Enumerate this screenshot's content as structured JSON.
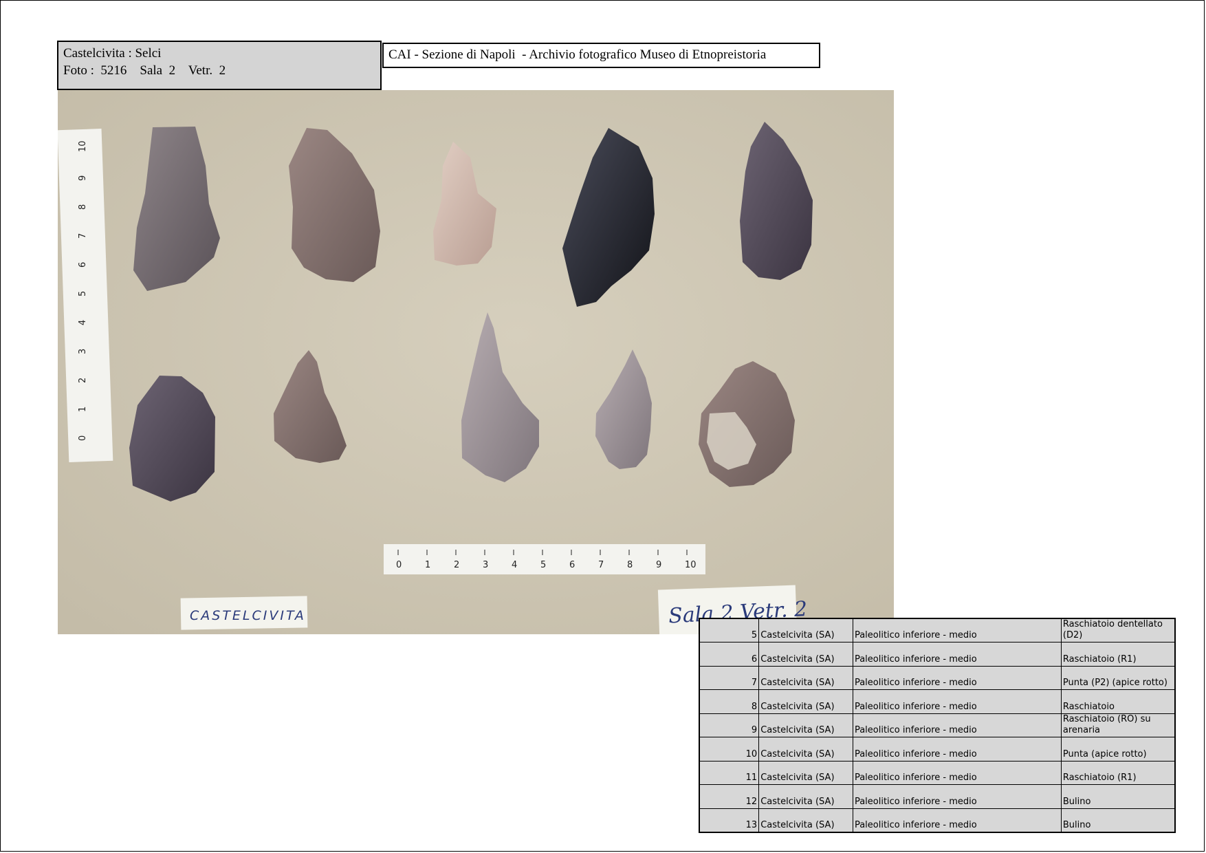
{
  "caption": {
    "line1": "Castelcivita : Selci",
    "line2": "Foto :  5216    Sala  2    Vetr.  2"
  },
  "archive_title": "CAI - Sezione di Napoli  - Archivio fotografico Museo di Etnopreistoria",
  "photo": {
    "label_left": "CASTELCIVITA",
    "label_right": "Sala 2  Vetr. 2",
    "ruler_ticks": [
      "0",
      "1",
      "2",
      "3",
      "4",
      "5",
      "6",
      "7",
      "8",
      "9",
      "10"
    ],
    "colors": {
      "background": "#cdc6b4",
      "label_paper": "#f4f4ee",
      "ink": "#2a3a7a"
    }
  },
  "catalog": {
    "rows": [
      {
        "num": "5",
        "site": "Castelcivita (SA)",
        "period": "Paleolitico inferiore - medio",
        "type": "Raschiatoio dentellato (D2)"
      },
      {
        "num": "6",
        "site": "Castelcivita (SA)",
        "period": "Paleolitico inferiore - medio",
        "type": "Raschiatoio (R1)"
      },
      {
        "num": "7",
        "site": "Castelcivita (SA)",
        "period": "Paleolitico inferiore - medio",
        "type": "Punta (P2) (apice rotto)"
      },
      {
        "num": "8",
        "site": "Castelcivita (SA)",
        "period": "Paleolitico inferiore - medio",
        "type": "Raschiatoio"
      },
      {
        "num": "9",
        "site": "Castelcivita (SA)",
        "period": "Paleolitico inferiore - medio",
        "type": "Raschiatoio  (RO) su arenaria"
      },
      {
        "num": "10",
        "site": "Castelcivita (SA)",
        "period": "Paleolitico inferiore - medio",
        "type": "Punta  (apice rotto)"
      },
      {
        "num": "11",
        "site": "Castelcivita (SA)",
        "period": "Paleolitico inferiore - medio",
        "type": "Raschiatoio (R1)"
      },
      {
        "num": "12",
        "site": "Castelcivita (SA)",
        "period": "Paleolitico inferiore - medio",
        "type": "Bulino"
      },
      {
        "num": "13",
        "site": "Castelcivita (SA)",
        "period": "Paleolitico inferiore - medio",
        "type": "Bulino"
      }
    ]
  }
}
